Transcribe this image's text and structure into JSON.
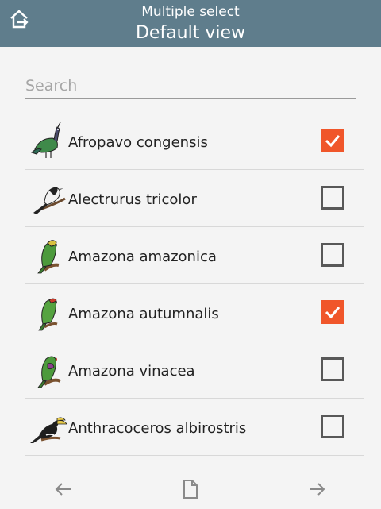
{
  "header": {
    "subtitle": "Multiple select",
    "title": "Default view",
    "color": "#5f7d8c"
  },
  "search": {
    "placeholder": "Search",
    "value": ""
  },
  "accent_color": "#f0562a",
  "items": [
    {
      "label": "Afropavo congensis",
      "checked": true,
      "icon": "congo-peafowl-icon"
    },
    {
      "label": "Alectrurus tricolor",
      "checked": false,
      "icon": "tyrant-flycatcher-icon"
    },
    {
      "label": "Amazona amazonica",
      "checked": false,
      "icon": "parrot-icon"
    },
    {
      "label": "Amazona autumnalis",
      "checked": true,
      "icon": "parrot-icon"
    },
    {
      "label": "Amazona vinacea",
      "checked": false,
      "icon": "parrot-icon"
    },
    {
      "label": "Anthracoceros albirostris",
      "checked": false,
      "icon": "hornbill-icon"
    }
  ],
  "footer": {
    "back_icon": "arrow-left-icon",
    "page_icon": "document-icon",
    "forward_icon": "arrow-right-icon"
  }
}
